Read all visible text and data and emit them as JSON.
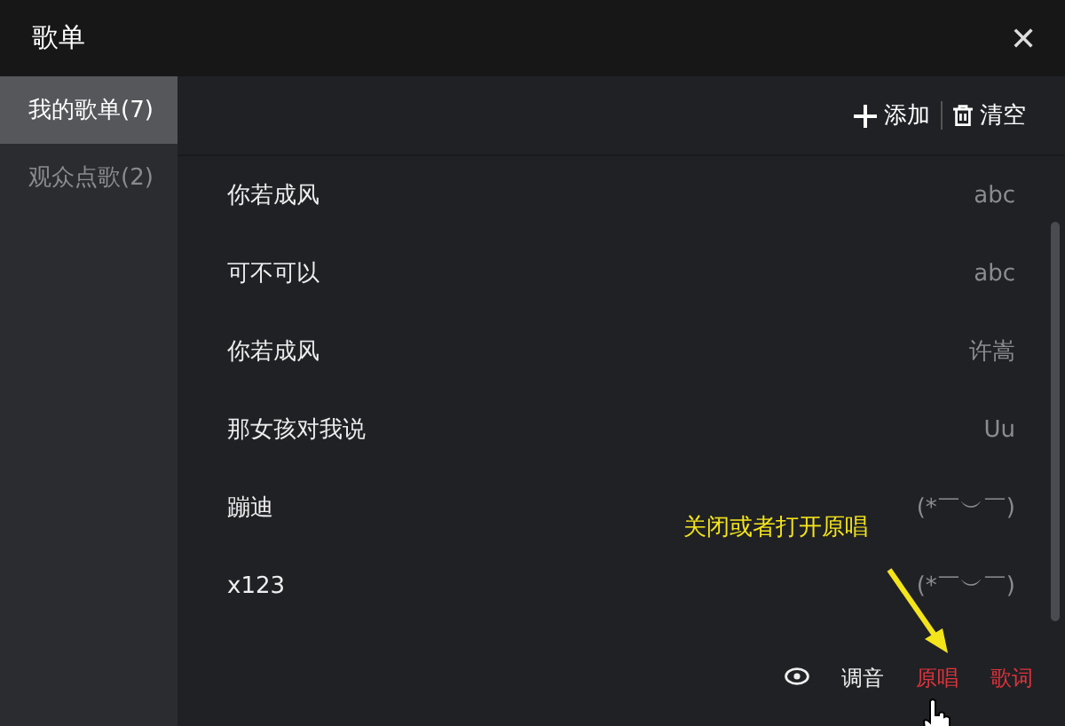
{
  "window": {
    "title": "歌单",
    "close": "✕"
  },
  "sidebar": {
    "items": [
      {
        "label": "我的歌单(7)",
        "selected": true
      },
      {
        "label": "观众点歌(2)",
        "selected": false
      }
    ]
  },
  "toolbar": {
    "add": "添加",
    "clear": "清空"
  },
  "songs": [
    {
      "title": "你若成风",
      "singer": "abc"
    },
    {
      "title": "可不可以",
      "singer": "abc"
    },
    {
      "title": "你若成风",
      "singer": "许嵩"
    },
    {
      "title": "那女孩对我说",
      "singer": "Uu"
    },
    {
      "title": "蹦迪",
      "singer": "(*￣︶￣)"
    },
    {
      "title": "x123",
      "singer": "(*￣︶￣)"
    }
  ],
  "bottom_bar": [
    {
      "kind": "icon"
    },
    {
      "kind": "text",
      "label": "调音",
      "on": false
    },
    {
      "kind": "text",
      "label": "原唱",
      "on": true
    },
    {
      "kind": "text",
      "label": "歌词",
      "on": true
    }
  ],
  "annotation": {
    "text": "关闭或者打开原唱"
  }
}
